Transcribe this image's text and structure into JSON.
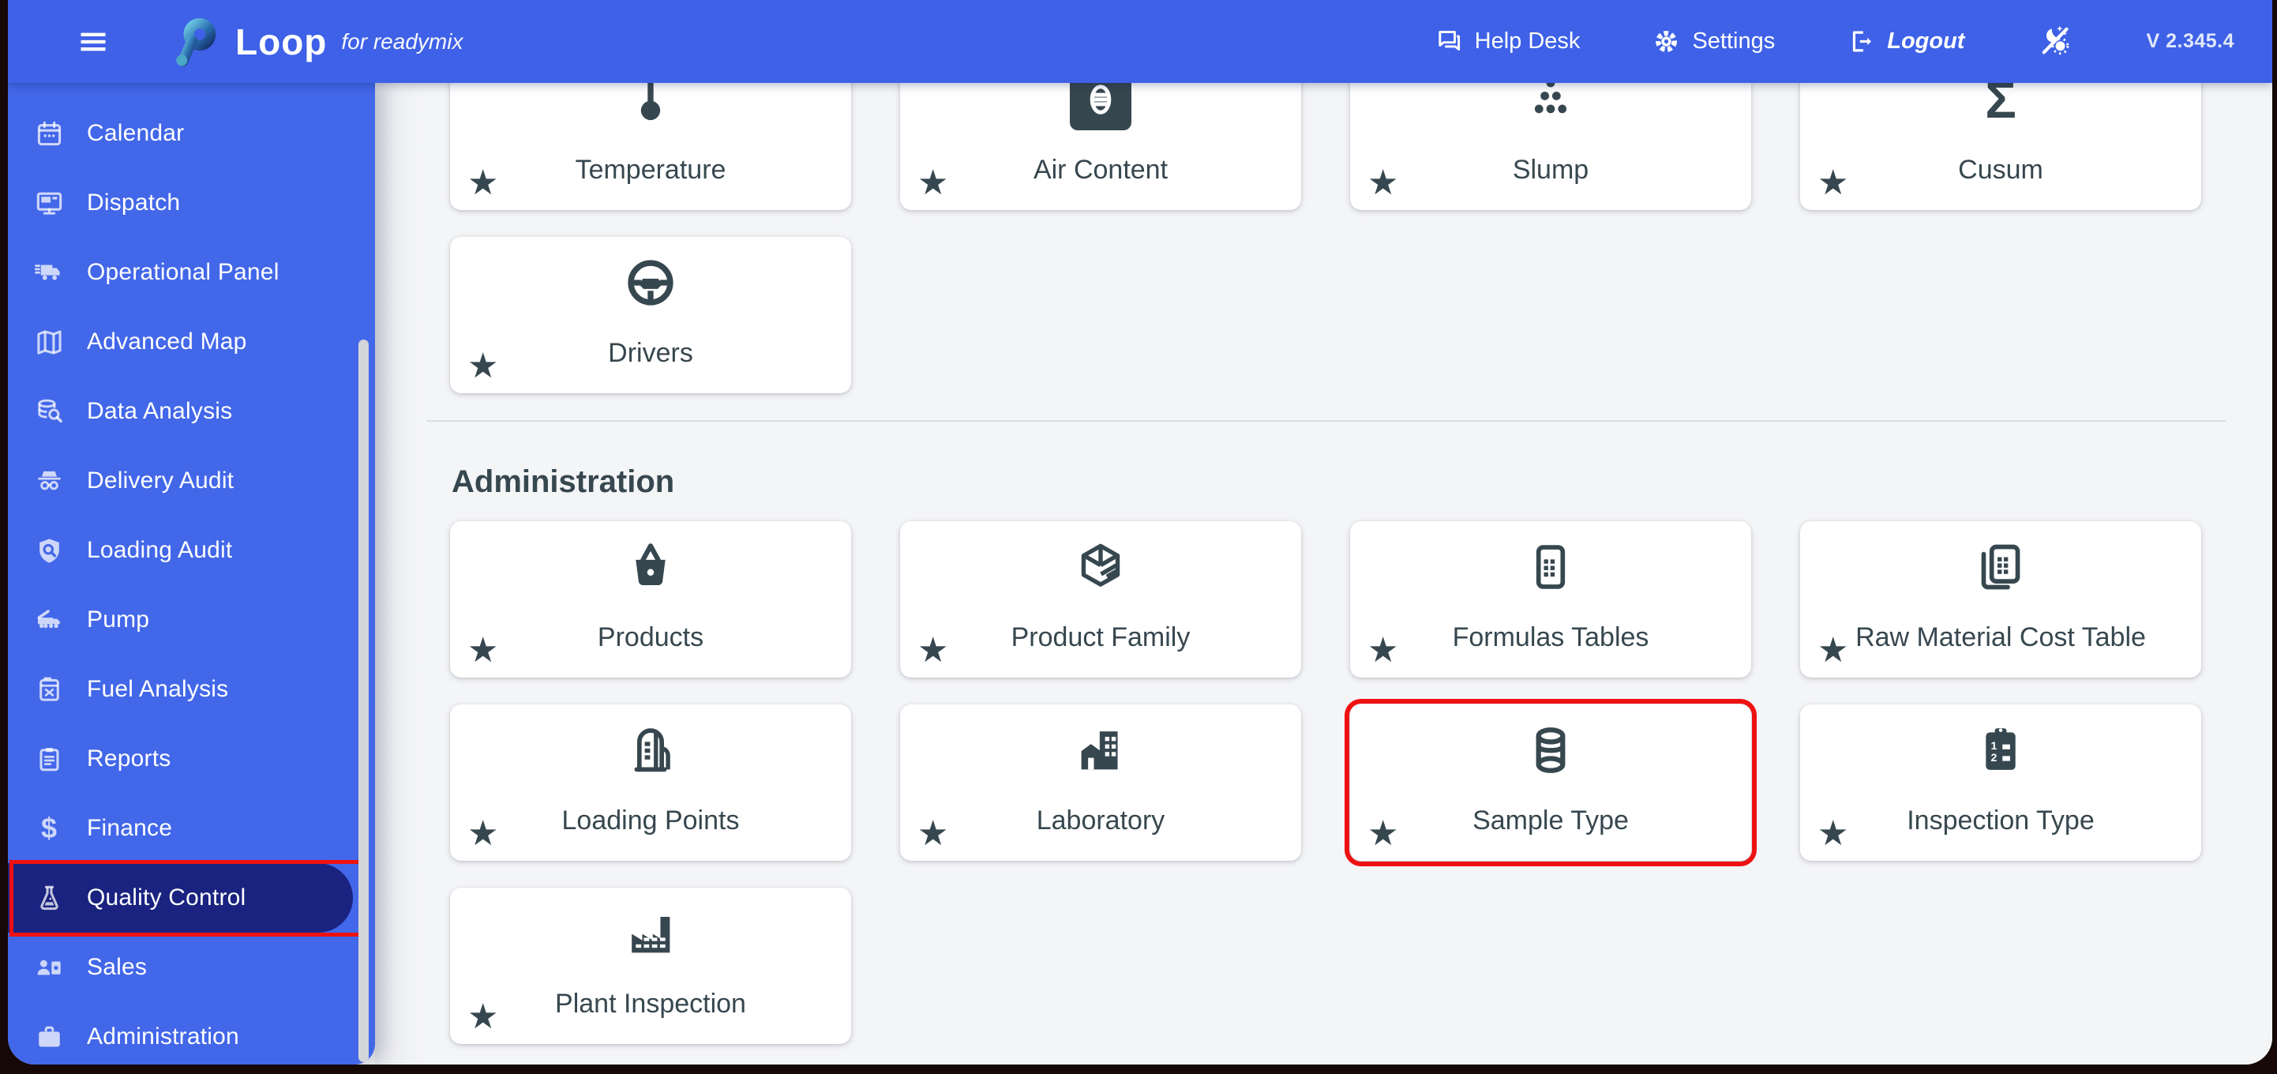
{
  "topbar": {
    "brand": {
      "name": "Loop",
      "suffix": "for readymix"
    },
    "actions": [
      {
        "id": "help-desk",
        "label": "Help Desk",
        "icon": "chat-icon"
      },
      {
        "id": "settings",
        "label": "Settings",
        "icon": "gear-icon"
      },
      {
        "id": "logout",
        "label": "Logout",
        "icon": "logout-icon",
        "italic": true
      }
    ],
    "theme_toggle_icon": "theme-toggle-icon",
    "version": "V 2.345.4"
  },
  "sidebar": {
    "items": [
      {
        "id": "calendar",
        "label": "Calendar",
        "icon": "calendar-icon"
      },
      {
        "id": "dispatch",
        "label": "Dispatch",
        "icon": "monitor-icon"
      },
      {
        "id": "operational-panel",
        "label": "Operational Panel",
        "icon": "truck-icon"
      },
      {
        "id": "advanced-map",
        "label": "Advanced Map",
        "icon": "map-icon"
      },
      {
        "id": "data-analysis",
        "label": "Data Analysis",
        "icon": "database-search-icon"
      },
      {
        "id": "delivery-audit",
        "label": "Delivery Audit",
        "icon": "incognito-icon"
      },
      {
        "id": "loading-audit",
        "label": "Loading Audit",
        "icon": "shield-search-icon"
      },
      {
        "id": "pump",
        "label": "Pump",
        "icon": "pump-truck-icon"
      },
      {
        "id": "fuel-analysis",
        "label": "Fuel Analysis",
        "icon": "jerrycan-icon"
      },
      {
        "id": "reports",
        "label": "Reports",
        "icon": "clipboard-icon"
      },
      {
        "id": "finance",
        "label": "Finance",
        "icon": "dollar-icon"
      },
      {
        "id": "quality-control",
        "label": "Quality Control",
        "icon": "flask-icon",
        "selected": true,
        "annotated": true
      },
      {
        "id": "sales",
        "label": "Sales",
        "icon": "sales-icon"
      },
      {
        "id": "administration",
        "label": "Administration",
        "icon": "briefcase-icon"
      }
    ]
  },
  "main": {
    "quality_cards": [
      {
        "id": "temperature",
        "label": "Temperature",
        "icon": "thermometer-icon"
      },
      {
        "id": "air-content",
        "label": "Air Content",
        "icon": "air-content-icon"
      },
      {
        "id": "slump",
        "label": "Slump",
        "icon": "slump-dots-icon"
      },
      {
        "id": "cusum",
        "label": "Cusum",
        "icon": "sigma-icon"
      },
      {
        "id": "drivers",
        "label": "Drivers",
        "icon": "steering-wheel-icon"
      }
    ],
    "section_title": "Administration",
    "admin_cards": [
      {
        "id": "products",
        "label": "Products",
        "icon": "basket-icon"
      },
      {
        "id": "product-family",
        "label": "Product Family",
        "icon": "package-icon"
      },
      {
        "id": "formulas-tables",
        "label": "Formulas Tables",
        "icon": "table-icon"
      },
      {
        "id": "raw-material-cost-table",
        "label": "Raw Material Cost Table",
        "icon": "stacked-table-icon"
      },
      {
        "id": "loading-points",
        "label": "Loading Points",
        "icon": "silo-icon"
      },
      {
        "id": "laboratory",
        "label": "Laboratory",
        "icon": "buildings-icon"
      },
      {
        "id": "sample-type",
        "label": "Sample Type",
        "icon": "cylinder-icon",
        "annotated": true
      },
      {
        "id": "inspection-type",
        "label": "Inspection Type",
        "icon": "inspection-clipboard-icon"
      },
      {
        "id": "plant-inspection",
        "label": "Plant Inspection",
        "icon": "factory-icon"
      }
    ],
    "favorite_star": "★"
  },
  "colors": {
    "topbar": "#3e61e7",
    "sidebar": "#4267e9",
    "selected_item": "#1a2380",
    "annotation": "#ee1111",
    "card_ink": "#37474f",
    "background": "#f4f5f7"
  }
}
